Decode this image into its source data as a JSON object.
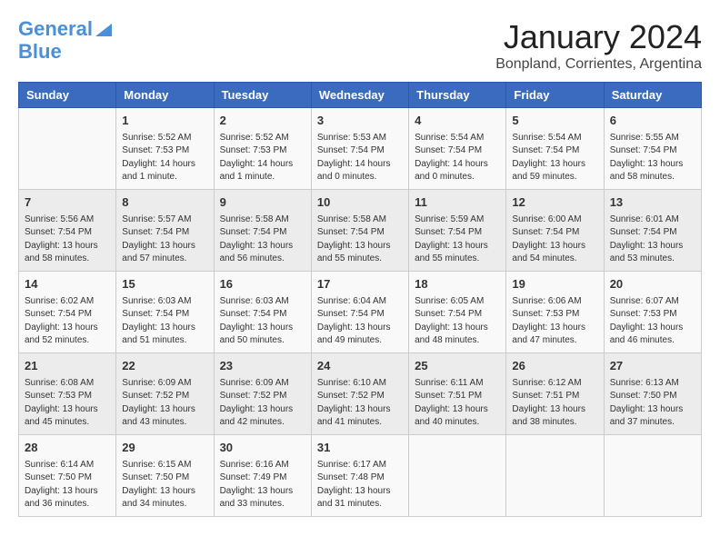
{
  "header": {
    "logo_line1": "General",
    "logo_line2": "Blue",
    "month": "January 2024",
    "location": "Bonpland, Corrientes, Argentina"
  },
  "weekdays": [
    "Sunday",
    "Monday",
    "Tuesday",
    "Wednesday",
    "Thursday",
    "Friday",
    "Saturday"
  ],
  "weeks": [
    [
      {
        "day": "",
        "info": ""
      },
      {
        "day": "1",
        "info": "Sunrise: 5:52 AM\nSunset: 7:53 PM\nDaylight: 14 hours\nand 1 minute."
      },
      {
        "day": "2",
        "info": "Sunrise: 5:52 AM\nSunset: 7:53 PM\nDaylight: 14 hours\nand 1 minute."
      },
      {
        "day": "3",
        "info": "Sunrise: 5:53 AM\nSunset: 7:54 PM\nDaylight: 14 hours\nand 0 minutes."
      },
      {
        "day": "4",
        "info": "Sunrise: 5:54 AM\nSunset: 7:54 PM\nDaylight: 14 hours\nand 0 minutes."
      },
      {
        "day": "5",
        "info": "Sunrise: 5:54 AM\nSunset: 7:54 PM\nDaylight: 13 hours\nand 59 minutes."
      },
      {
        "day": "6",
        "info": "Sunrise: 5:55 AM\nSunset: 7:54 PM\nDaylight: 13 hours\nand 58 minutes."
      }
    ],
    [
      {
        "day": "7",
        "info": "Sunrise: 5:56 AM\nSunset: 7:54 PM\nDaylight: 13 hours\nand 58 minutes."
      },
      {
        "day": "8",
        "info": "Sunrise: 5:57 AM\nSunset: 7:54 PM\nDaylight: 13 hours\nand 57 minutes."
      },
      {
        "day": "9",
        "info": "Sunrise: 5:58 AM\nSunset: 7:54 PM\nDaylight: 13 hours\nand 56 minutes."
      },
      {
        "day": "10",
        "info": "Sunrise: 5:58 AM\nSunset: 7:54 PM\nDaylight: 13 hours\nand 55 minutes."
      },
      {
        "day": "11",
        "info": "Sunrise: 5:59 AM\nSunset: 7:54 PM\nDaylight: 13 hours\nand 55 minutes."
      },
      {
        "day": "12",
        "info": "Sunrise: 6:00 AM\nSunset: 7:54 PM\nDaylight: 13 hours\nand 54 minutes."
      },
      {
        "day": "13",
        "info": "Sunrise: 6:01 AM\nSunset: 7:54 PM\nDaylight: 13 hours\nand 53 minutes."
      }
    ],
    [
      {
        "day": "14",
        "info": "Sunrise: 6:02 AM\nSunset: 7:54 PM\nDaylight: 13 hours\nand 52 minutes."
      },
      {
        "day": "15",
        "info": "Sunrise: 6:03 AM\nSunset: 7:54 PM\nDaylight: 13 hours\nand 51 minutes."
      },
      {
        "day": "16",
        "info": "Sunrise: 6:03 AM\nSunset: 7:54 PM\nDaylight: 13 hours\nand 50 minutes."
      },
      {
        "day": "17",
        "info": "Sunrise: 6:04 AM\nSunset: 7:54 PM\nDaylight: 13 hours\nand 49 minutes."
      },
      {
        "day": "18",
        "info": "Sunrise: 6:05 AM\nSunset: 7:54 PM\nDaylight: 13 hours\nand 48 minutes."
      },
      {
        "day": "19",
        "info": "Sunrise: 6:06 AM\nSunset: 7:53 PM\nDaylight: 13 hours\nand 47 minutes."
      },
      {
        "day": "20",
        "info": "Sunrise: 6:07 AM\nSunset: 7:53 PM\nDaylight: 13 hours\nand 46 minutes."
      }
    ],
    [
      {
        "day": "21",
        "info": "Sunrise: 6:08 AM\nSunset: 7:53 PM\nDaylight: 13 hours\nand 45 minutes."
      },
      {
        "day": "22",
        "info": "Sunrise: 6:09 AM\nSunset: 7:52 PM\nDaylight: 13 hours\nand 43 minutes."
      },
      {
        "day": "23",
        "info": "Sunrise: 6:09 AM\nSunset: 7:52 PM\nDaylight: 13 hours\nand 42 minutes."
      },
      {
        "day": "24",
        "info": "Sunrise: 6:10 AM\nSunset: 7:52 PM\nDaylight: 13 hours\nand 41 minutes."
      },
      {
        "day": "25",
        "info": "Sunrise: 6:11 AM\nSunset: 7:51 PM\nDaylight: 13 hours\nand 40 minutes."
      },
      {
        "day": "26",
        "info": "Sunrise: 6:12 AM\nSunset: 7:51 PM\nDaylight: 13 hours\nand 38 minutes."
      },
      {
        "day": "27",
        "info": "Sunrise: 6:13 AM\nSunset: 7:50 PM\nDaylight: 13 hours\nand 37 minutes."
      }
    ],
    [
      {
        "day": "28",
        "info": "Sunrise: 6:14 AM\nSunset: 7:50 PM\nDaylight: 13 hours\nand 36 minutes."
      },
      {
        "day": "29",
        "info": "Sunrise: 6:15 AM\nSunset: 7:50 PM\nDaylight: 13 hours\nand 34 minutes."
      },
      {
        "day": "30",
        "info": "Sunrise: 6:16 AM\nSunset: 7:49 PM\nDaylight: 13 hours\nand 33 minutes."
      },
      {
        "day": "31",
        "info": "Sunrise: 6:17 AM\nSunset: 7:48 PM\nDaylight: 13 hours\nand 31 minutes."
      },
      {
        "day": "",
        "info": ""
      },
      {
        "day": "",
        "info": ""
      },
      {
        "day": "",
        "info": ""
      }
    ]
  ]
}
